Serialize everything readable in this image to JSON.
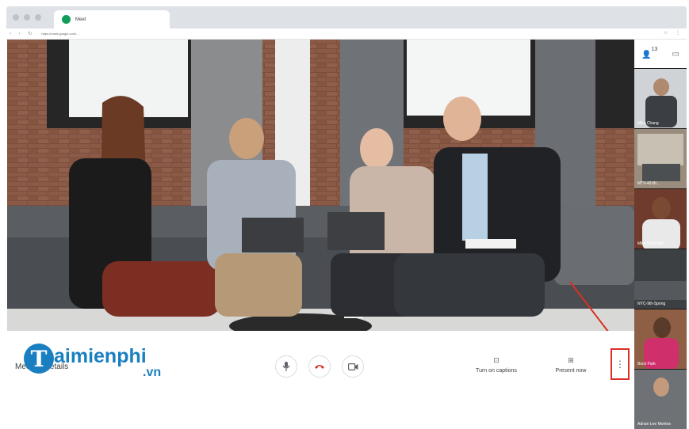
{
  "browser": {
    "tab_title": "Meet",
    "url": "https://meet.google.com/..."
  },
  "sidebar": {
    "participant_count": "13",
    "tiles": [
      {
        "name": "Mike Chang"
      },
      {
        "name": "MTV-42-Bl..."
      },
      {
        "name": "Mike Marchetti"
      },
      {
        "name": "NYC-9th-Spring"
      },
      {
        "name": "Beck Park"
      },
      {
        "name": "Adrian Lee Montes"
      }
    ]
  },
  "controls": {
    "meeting_details_label": "Meeting details",
    "captions_label": "Turn on captions",
    "present_label": "Present now"
  },
  "watermark": {
    "logo_letter": "T",
    "name": "aimienphi",
    "suffix": ".vn"
  },
  "colors": {
    "accent": "#1a73e8",
    "end_call": "#d93025",
    "highlight": "#d93025",
    "watermark": "#1a7fc1"
  }
}
